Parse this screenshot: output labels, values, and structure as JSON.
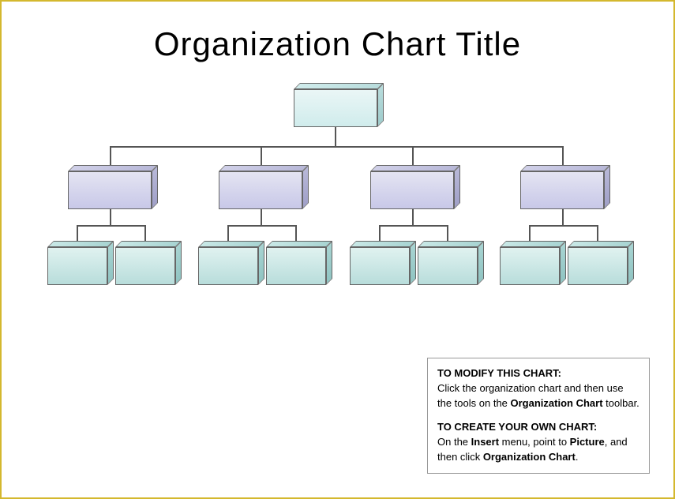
{
  "title": "Organization Chart Title",
  "instructions": {
    "modify_heading": "TO MODIFY THIS CHART:",
    "modify_text_a": "Click the organization chart and then use the tools on the ",
    "modify_bold": "Organization Chart",
    "modify_text_b": " toolbar.",
    "create_heading": "TO CREATE YOUR OWN CHART:",
    "create_text_a": "On the ",
    "create_bold1": "Insert",
    "create_text_b": " menu, point to ",
    "create_bold2": "Picture",
    "create_text_c": ", and then click ",
    "create_bold3": "Organization Chart",
    "create_text_d": "."
  }
}
